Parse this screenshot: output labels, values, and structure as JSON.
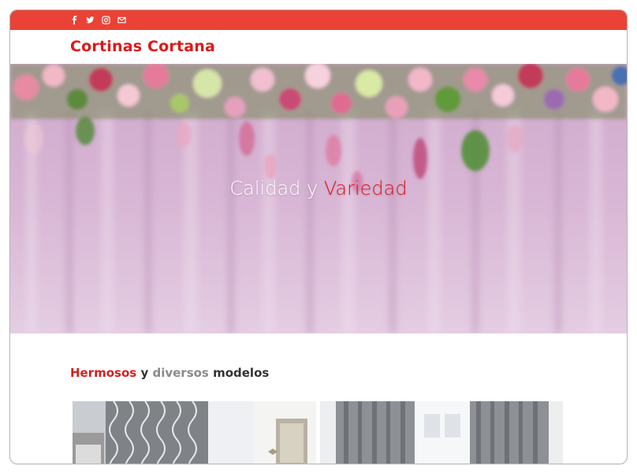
{
  "social": {
    "icons": [
      "facebook-icon",
      "twitter-icon",
      "instagram-icon",
      "email-icon"
    ]
  },
  "brand": {
    "name": "Cortinas Cortana",
    "color": "#e01818"
  },
  "hero": {
    "title_part1": "Calidad y ",
    "title_part2": "Variedad",
    "accent_color": "#e01818"
  },
  "section": {
    "word1": "Hermosos",
    "word2": " y ",
    "word3": "diversos",
    "word4": " modelos"
  },
  "colors": {
    "topbar": "#ea4236",
    "accent": "#e01818"
  }
}
